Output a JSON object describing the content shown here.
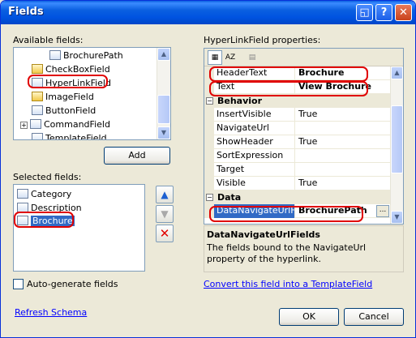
{
  "window": {
    "title": "Fields"
  },
  "titlebar_buttons": {
    "restore": "◱",
    "help": "?",
    "close": "✕"
  },
  "available": {
    "label": "Available fields:",
    "items": [
      "BrochurePath",
      "CheckBoxField",
      "HyperLinkField",
      "ImageField",
      "ButtonField",
      "CommandField",
      "TemplateField"
    ],
    "add_button": "Add"
  },
  "selected": {
    "label": "Selected fields:",
    "items": [
      "Category",
      "Description",
      "Brochure"
    ]
  },
  "properties": {
    "label": "HyperLinkField properties:",
    "rows": [
      {
        "name": "HeaderText",
        "value": "Brochure"
      },
      {
        "name": "Text",
        "value": "View Brochure"
      }
    ],
    "behavior": {
      "label": "Behavior",
      "rows": [
        {
          "name": "InsertVisible",
          "value": "True"
        },
        {
          "name": "NavigateUrl",
          "value": ""
        },
        {
          "name": "ShowHeader",
          "value": "True"
        },
        {
          "name": "SortExpression",
          "value": ""
        },
        {
          "name": "Target",
          "value": ""
        },
        {
          "name": "Visible",
          "value": "True"
        }
      ]
    },
    "data": {
      "label": "Data",
      "rows": [
        {
          "name": "DataNavigateUrlFiel",
          "value": "BrochurePath"
        }
      ]
    },
    "ellipsis_button": "..."
  },
  "description": {
    "title": "DataNavigateUrlFields",
    "text": "The fields bound to the NavigateUrl property of the hyperlink."
  },
  "auto_generate": {
    "label": "Auto-generate fields",
    "checked": false
  },
  "convert_link": "Convert this field into a TemplateField",
  "refresh_link": "Refresh Schema",
  "ok_button": "OK",
  "cancel_button": "Cancel",
  "colors": {
    "highlight": "#e00000",
    "title_blue": "#0a5fe0",
    "selection": "#316ac5"
  }
}
